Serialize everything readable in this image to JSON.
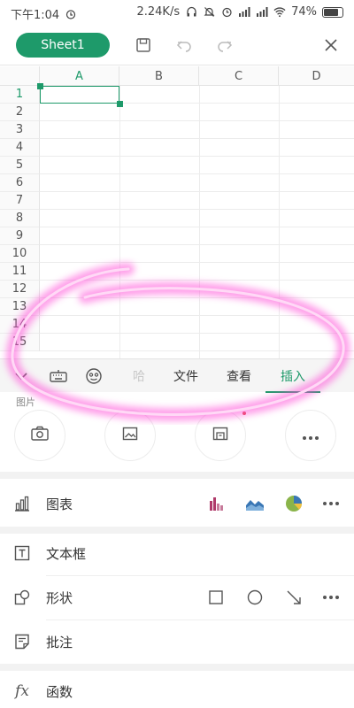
{
  "status_bar": {
    "time": "下午1:04",
    "speed": "2.24K/s",
    "battery": "74%"
  },
  "toolbar": {
    "sheet_name": "Sheet1",
    "icons": [
      "save-icon",
      "undo-icon",
      "redo-icon",
      "close-icon"
    ]
  },
  "grid": {
    "columns": [
      "A",
      "B",
      "C",
      "D"
    ],
    "rows": [
      "1",
      "2",
      "3",
      "4",
      "5",
      "6",
      "7",
      "8",
      "9",
      "10",
      "11",
      "12",
      "13",
      "14",
      "15"
    ],
    "selected_cell": "A1"
  },
  "tool_strip": {
    "partial_left": "哈",
    "tabs": [
      "文件",
      "查看",
      "插入"
    ],
    "active_tab": "插入"
  },
  "image_section": {
    "label": "图片",
    "buttons": [
      "camera-icon",
      "gallery-icon",
      "image-insert-icon",
      "more-icon"
    ]
  },
  "options": {
    "chart_label": "图表",
    "textbox_label": "文本框",
    "shape_label": "形状",
    "comment_label": "批注",
    "function_label": "函数"
  },
  "colors": {
    "accent": "#1e9a6a",
    "scribble": "#ff4fd8",
    "chart_bar": "#b03a6a",
    "chart_area": "#3a77b5",
    "chart_pie": "#8ab44a"
  }
}
